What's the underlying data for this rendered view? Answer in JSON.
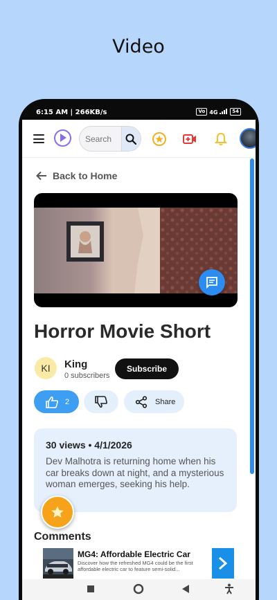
{
  "page": {
    "heading": "Video"
  },
  "status_bar": {
    "time": "6:15 AM | 266KB/s",
    "vo_label": "Vo",
    "lte_label": "4G",
    "battery": "54"
  },
  "toolbar": {
    "menu_icon": "hamburger-icon",
    "logo_icon": "play-circle-icon",
    "search": {
      "placeholder": "Search",
      "value": ""
    },
    "search_icon": "search-icon",
    "icons": [
      "star-circle-icon",
      "video-camera-icon",
      "bell-icon",
      "avatar"
    ]
  },
  "nav": {
    "back_label": "Back to Home"
  },
  "video": {
    "title": "Horror Movie Short",
    "chat_icon": "chat-icon"
  },
  "channel": {
    "initials": "KI",
    "name": "King",
    "subscribers": "0 subscribers",
    "subscribe_label": "Subscribe"
  },
  "actions": {
    "like_count": "2",
    "share_label": "Share"
  },
  "info": {
    "meta": "30 views • 4/1/2026",
    "description": "Dev Malhotra is returning home when his car breaks down at night, and a mysterious woman emerges, seeking his help."
  },
  "comments": {
    "heading": "Comments"
  },
  "ad": {
    "title": "MG4: Affordable Electric Car",
    "subtitle": "Discover how the refreshed MG4 could be the first affordable electric car to feature semi-solid..."
  },
  "colors": {
    "background": "#b7d6fb",
    "accent_blue": "#3d9ef2",
    "logo_purple": "#8a6cf1",
    "fab_orange": "#f6a31b",
    "video_red": "#e53935",
    "bell_yellow": "#f2c12e"
  }
}
